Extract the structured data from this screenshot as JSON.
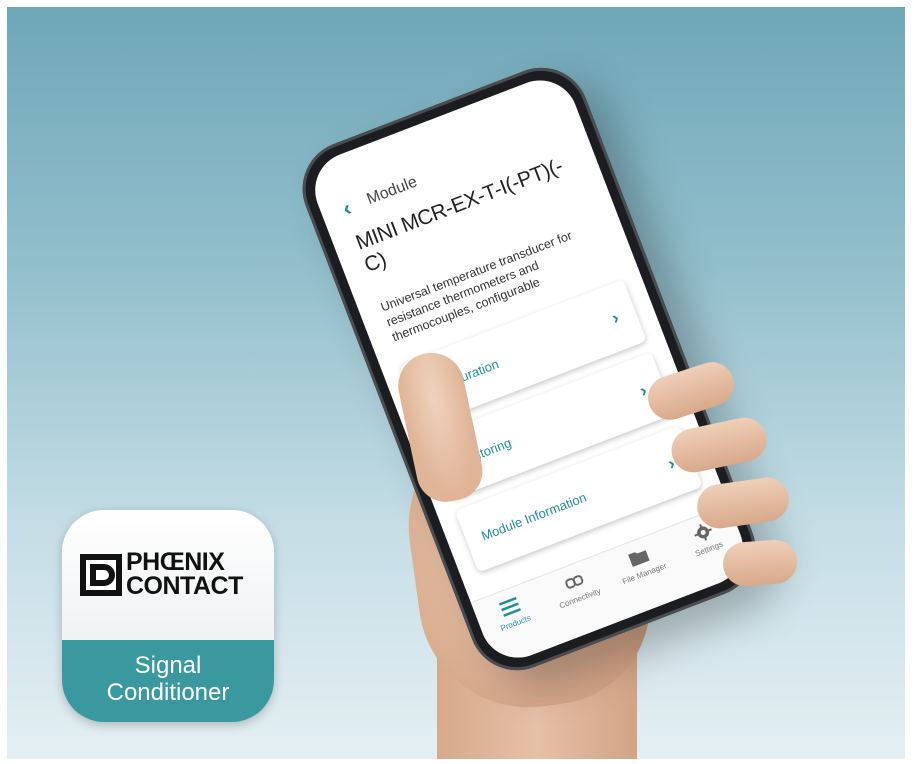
{
  "app_icon": {
    "brand_line1": "PHŒNIX",
    "brand_line2": "CONTACT",
    "app_name_line1": "Signal",
    "app_name_line2": "Conditioner",
    "band_color": "#3a989f"
  },
  "phone_screen": {
    "header": {
      "back_icon": "chevron-left-icon",
      "section_label": "Module",
      "title": "MINI MCR-EX-T-I(-PT)(-C)"
    },
    "description": "Universal temperature transducer for resistance thermometers and thermocouples, configurable",
    "menu_items": [
      {
        "label": "Configuration",
        "icon": "chevron-right-icon"
      },
      {
        "label": "Monitoring",
        "icon": "chevron-right-icon"
      },
      {
        "label": "Module Information",
        "icon": "chevron-right-icon"
      }
    ],
    "tab_bar": [
      {
        "label": "Products",
        "icon": "list-icon",
        "active": true
      },
      {
        "label": "Connectivity",
        "icon": "link-icon",
        "active": false
      },
      {
        "label": "File Manager",
        "icon": "folder-icon",
        "active": false
      },
      {
        "label": "Settings",
        "icon": "gear-icon",
        "active": false
      }
    ],
    "accent_color": "#1d8f99"
  }
}
